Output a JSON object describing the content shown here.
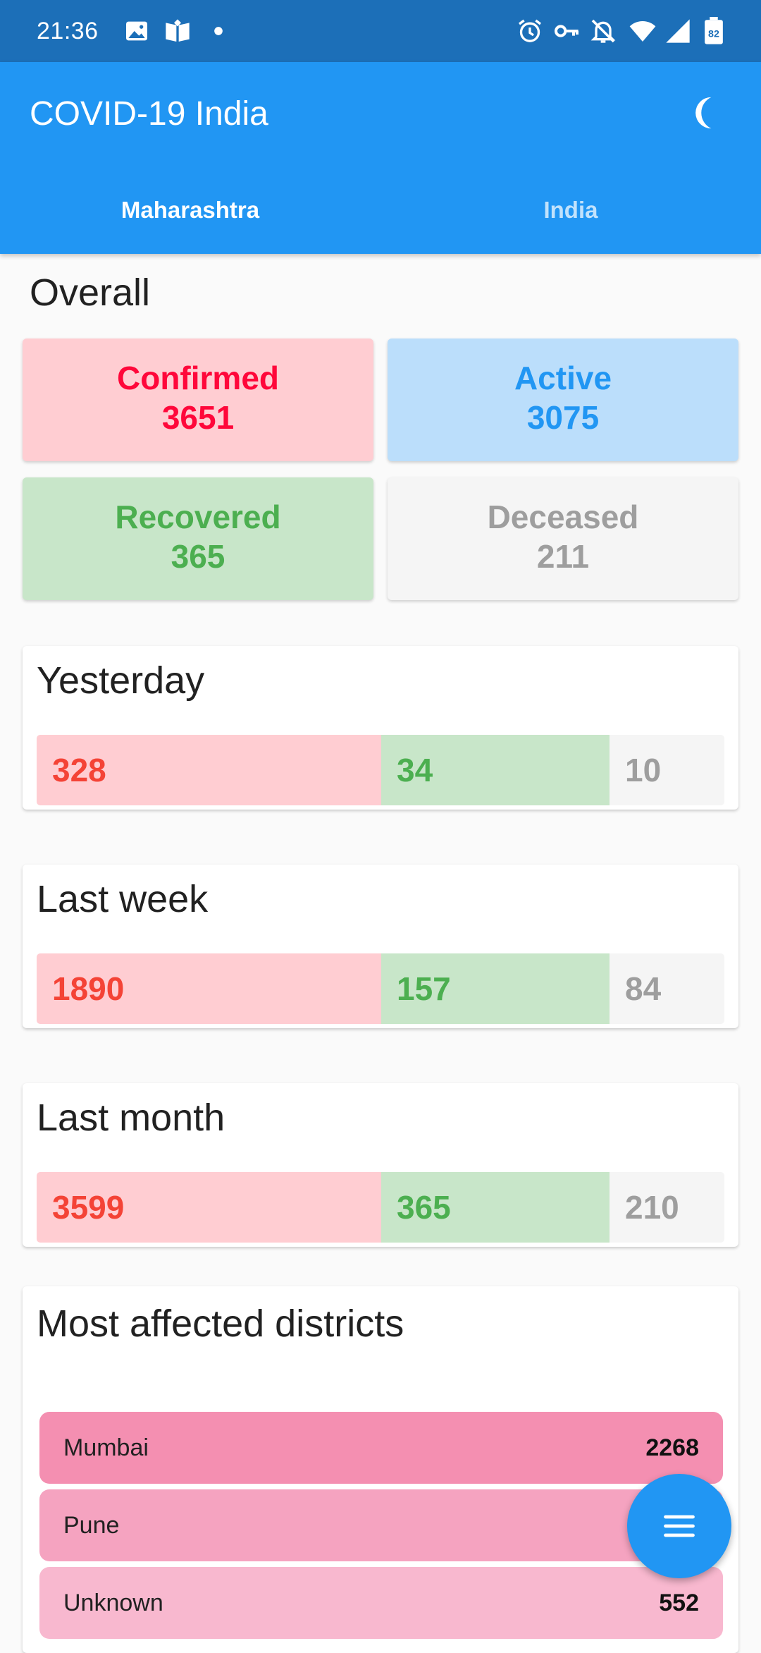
{
  "status_bar": {
    "time": "21:36",
    "battery_level": "82",
    "icons": [
      "image-icon",
      "book-icon",
      "dot-icon",
      "alarm-icon",
      "vpn-key-icon",
      "notifications-off-icon",
      "wifi-icon",
      "signal-icon",
      "battery-icon"
    ]
  },
  "app_bar": {
    "title": "COVID-19 India",
    "theme_icon": "moon-icon",
    "tabs": [
      {
        "label": "Maharashtra",
        "selected": true
      },
      {
        "label": "India",
        "selected": false
      }
    ]
  },
  "overall": {
    "title": "Overall",
    "confirmed": {
      "label": "Confirmed",
      "value": "3651"
    },
    "active": {
      "label": "Active",
      "value": "3075"
    },
    "recovered": {
      "label": "Recovered",
      "value": "365"
    },
    "deceased": {
      "label": "Deceased",
      "value": "211"
    }
  },
  "periods": {
    "yesterday": {
      "title": "Yesterday",
      "confirmed": "328",
      "recovered": "34",
      "deceased": "10"
    },
    "last_week": {
      "title": "Last week",
      "confirmed": "1890",
      "recovered": "157",
      "deceased": "84"
    },
    "last_month": {
      "title": "Last month",
      "confirmed": "3599",
      "recovered": "365",
      "deceased": "210"
    }
  },
  "districts": {
    "title": "Most affected districts",
    "items": [
      {
        "name": "Mumbai",
        "count": "2268"
      },
      {
        "name": "Pune",
        "count": ""
      },
      {
        "name": "Unknown",
        "count": "552"
      }
    ]
  },
  "fab": {
    "icon": "menu-icon"
  },
  "colors": {
    "status_bar": "#1c6fb8",
    "app_bar": "#2196f3",
    "confirmed": "#ff073a",
    "active": "#2196f3",
    "recovered": "#4caf50",
    "deceased": "#9e9e9e"
  }
}
